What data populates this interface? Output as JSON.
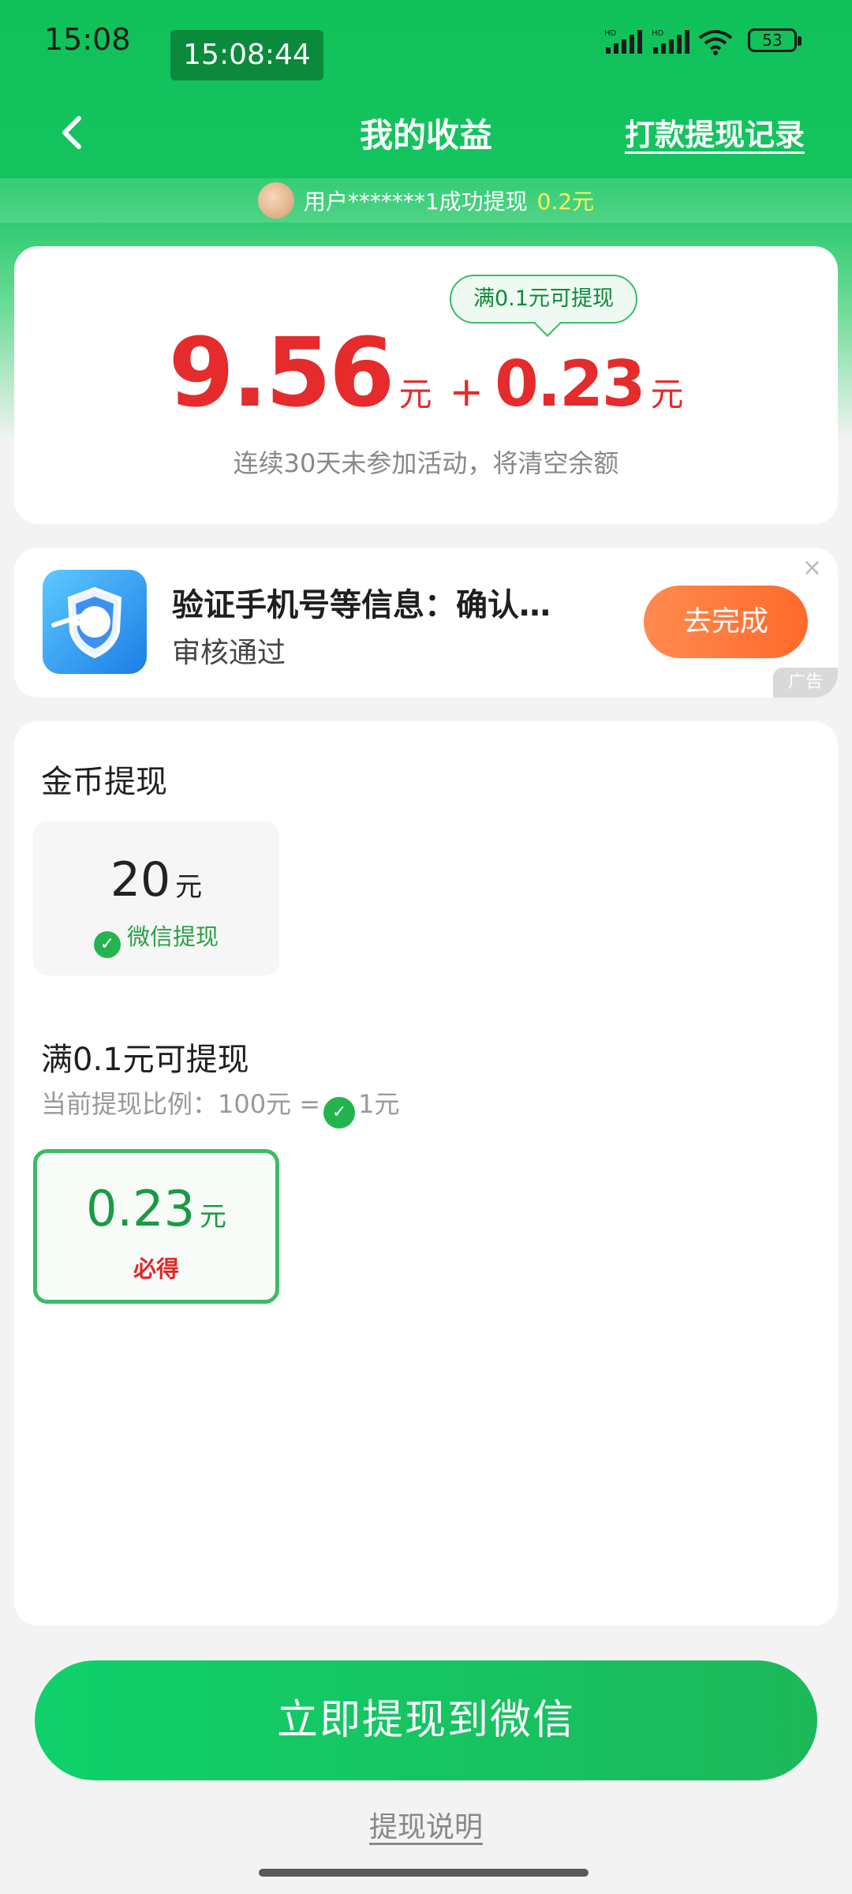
{
  "status_bar": {
    "time": "15:08",
    "clock_pill": "15:08:44",
    "network_1": "HD",
    "network_2": "HD",
    "battery": "53"
  },
  "nav": {
    "title": "我的收益",
    "record_link": "打款提现记录"
  },
  "notice": {
    "text": "用户*******1成功提现",
    "amount": "0.2元"
  },
  "balance": {
    "tip": "满0.1元可提现",
    "main_amount": "9.56",
    "main_unit": "元",
    "plus": "+",
    "extra_amount": "0.23",
    "extra_unit": "元",
    "note": "连续30天未参加活动，将清空余额"
  },
  "ad": {
    "title": "验证手机号等信息：确认…",
    "subtitle": "审核通过",
    "button": "去完成",
    "tag": "广告",
    "close": "×"
  },
  "withdraw": {
    "coin_title": "金币提现",
    "coin_option": {
      "amount": "20",
      "unit": "元",
      "method": "微信提现"
    },
    "threshold_title": "满0.1元可提现",
    "ratio_prefix": "当前提现比例：100元 =",
    "ratio_suffix": "1元",
    "selected_option": {
      "amount": "0.23",
      "unit": "元",
      "label": "必得"
    }
  },
  "cta": "立即提现到微信",
  "explain_link": "提现说明",
  "colors": {
    "brand_green": "#10c15a",
    "amount_red": "#e52b2b",
    "ad_button_orange": "#ff7a3a"
  }
}
